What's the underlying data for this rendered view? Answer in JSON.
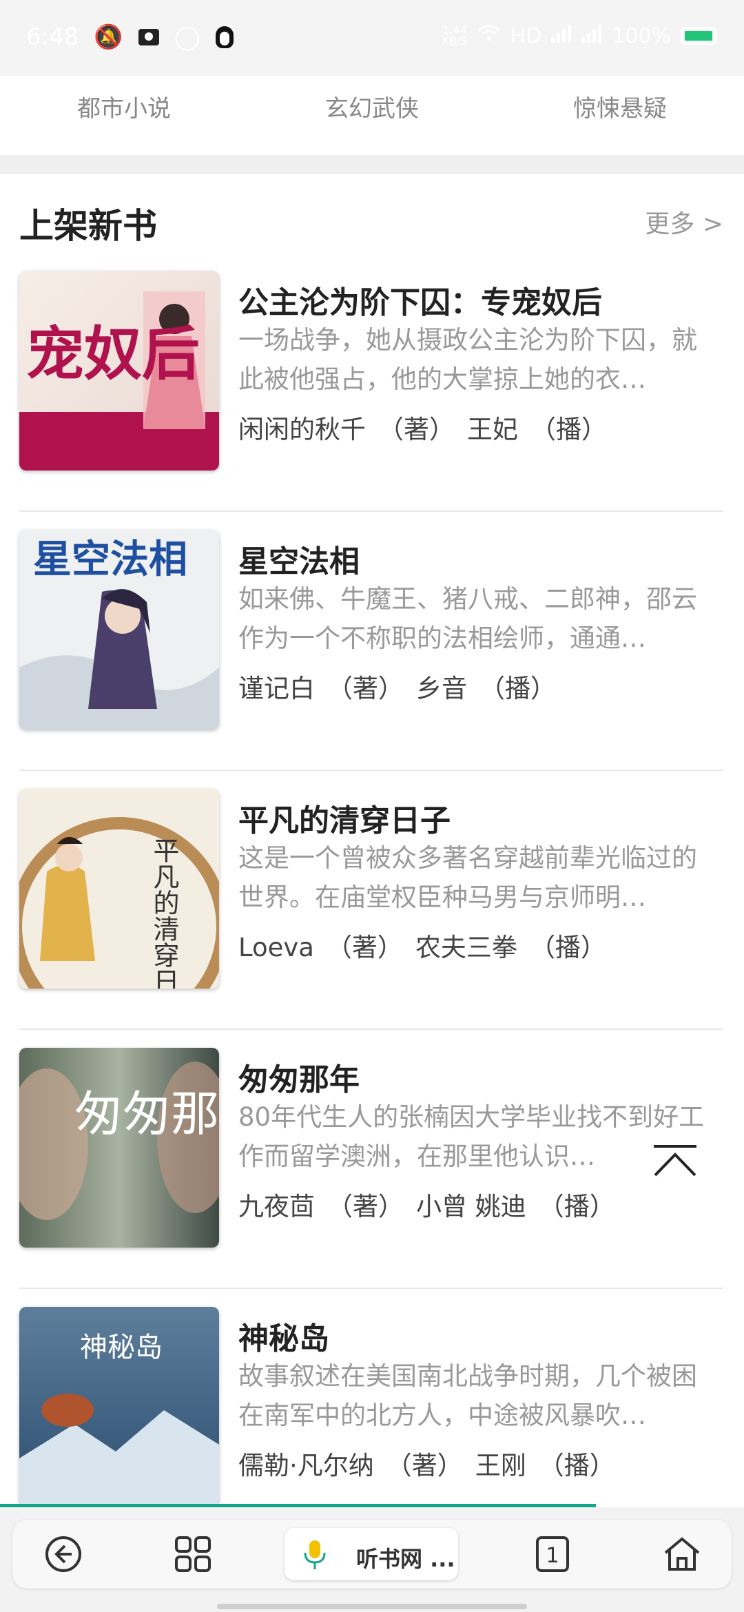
{
  "status_bar": {
    "time": "6:48",
    "network_speed": "1.44",
    "network_unit": "KB/S",
    "signal_label": "HD",
    "battery": "100%"
  },
  "categories": [
    "都市小说",
    "玄幻武侠",
    "惊悚悬疑"
  ],
  "section": {
    "title": "上架新书",
    "more": "更多 >"
  },
  "books": [
    {
      "title": "公主沦为阶下囚：专宠奴后",
      "desc": "一场战争，她从摄政公主沦为阶下囚，就此被他强占，他的大掌掠上她的衣…",
      "author": "闲闲的秋千",
      "author_tag": "（著）",
      "narrator": "王妃",
      "narrator_tag": "（播）",
      "cover_text": "宠奴后"
    },
    {
      "title": "星空法相",
      "desc": "如来佛、牛魔王、猪八戒、二郎神，邵云作为一个不称职的法相绘师，通通…",
      "author": "谨记白",
      "author_tag": "（著）",
      "narrator": "乡音",
      "narrator_tag": "（播）",
      "cover_text": "星空法相"
    },
    {
      "title": "平凡的清穿日子",
      "desc": "这是一个曾被众多著名穿越前辈光临过的世界。在庙堂权臣种马男与京师明…",
      "author": "Loeva",
      "author_tag": "（著）",
      "narrator": "农夫三拳",
      "narrator_tag": "（播）",
      "cover_text": "平凡的清穿日子"
    },
    {
      "title": "匆匆那年",
      "desc": "80年代生人的张楠因大学毕业找不到好工作而留学澳洲，在那里他认识…",
      "author": "九夜茴",
      "author_tag": "（著）",
      "narrator": "小曾 姚迪",
      "narrator_tag": "（播）",
      "cover_text": "匆匆那年"
    },
    {
      "title": "神秘岛",
      "desc": "故事叙述在美国南北战争时期，几个被困在南军中的北方人，中途被风暴吹…",
      "author": "儒勒·凡尔纳",
      "author_tag": "（著）",
      "narrator": "王刚",
      "narrator_tag": "（播）",
      "cover_text": "神秘岛"
    }
  ],
  "bottom_bar": {
    "tab_label": "听书网 ...",
    "tab_count": "1"
  },
  "colors": {
    "accent": "#17a589",
    "mic": "#f2c200",
    "battery": "#22c47a"
  }
}
